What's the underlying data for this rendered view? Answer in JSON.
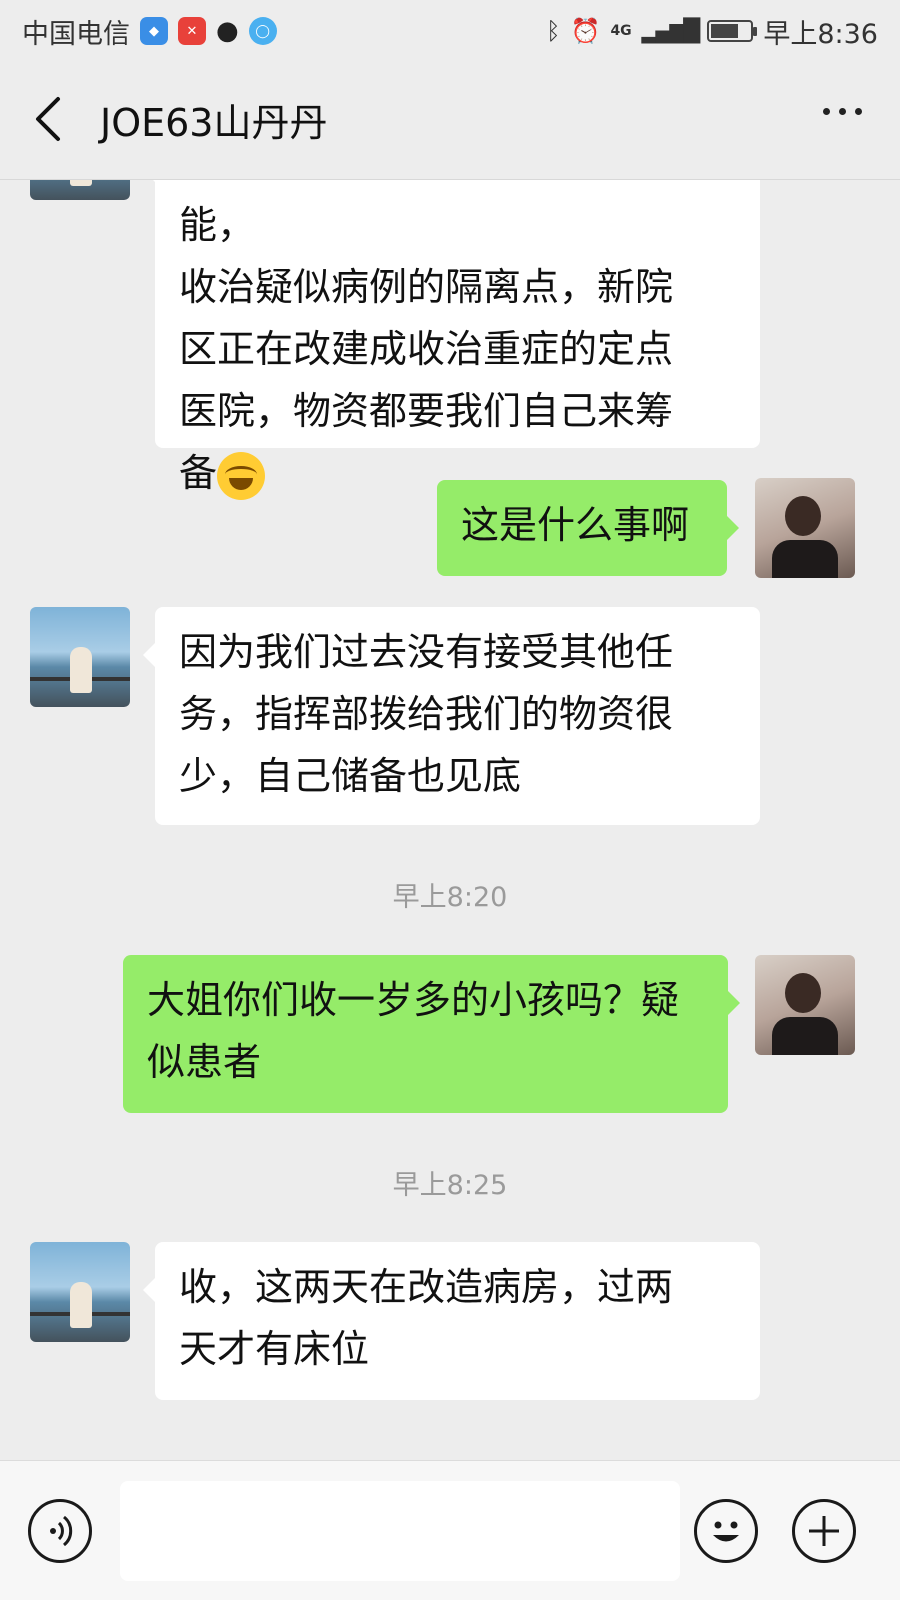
{
  "status_bar": {
    "carrier": "中国电信",
    "network": "4G",
    "time": "早上8:36",
    "battery_level": 0.7
  },
  "header": {
    "title": "JOE63山丹丹"
  },
  "messages": [
    {
      "side": "left",
      "text_lines": [
        "我们接手个收治轻症病例的功能，",
        "收治疑似病例的隔离点，新院",
        "区正在改建成收治重症的定点",
        "医院，物资都要我们自己来筹",
        "备"
      ],
      "emoji": "laughing-with-tears"
    },
    {
      "side": "right",
      "text_lines": [
        "这是什么事啊"
      ]
    },
    {
      "side": "left",
      "text_lines": [
        "因为我们过去没有接受其他任",
        "务，指挥部拨给我们的物资很",
        "少，自己储备也见底"
      ]
    },
    {
      "side": "time",
      "text": "早上8:20"
    },
    {
      "side": "right",
      "text_lines": [
        "大姐你们收一岁多的小孩吗？疑",
        "似患者"
      ]
    },
    {
      "side": "time",
      "text": "早上8:25"
    },
    {
      "side": "left",
      "text_lines": [
        "收，这两天在改造病房，过两",
        "天才有床位"
      ]
    }
  ],
  "input_bar": {
    "voice_icon": "voice-icon",
    "emoji_icon": "emoji-icon",
    "add_icon": "add-icon"
  },
  "colors": {
    "background": "#ededed",
    "bubble_self": "#95ec69",
    "bubble_other": "#ffffff"
  }
}
